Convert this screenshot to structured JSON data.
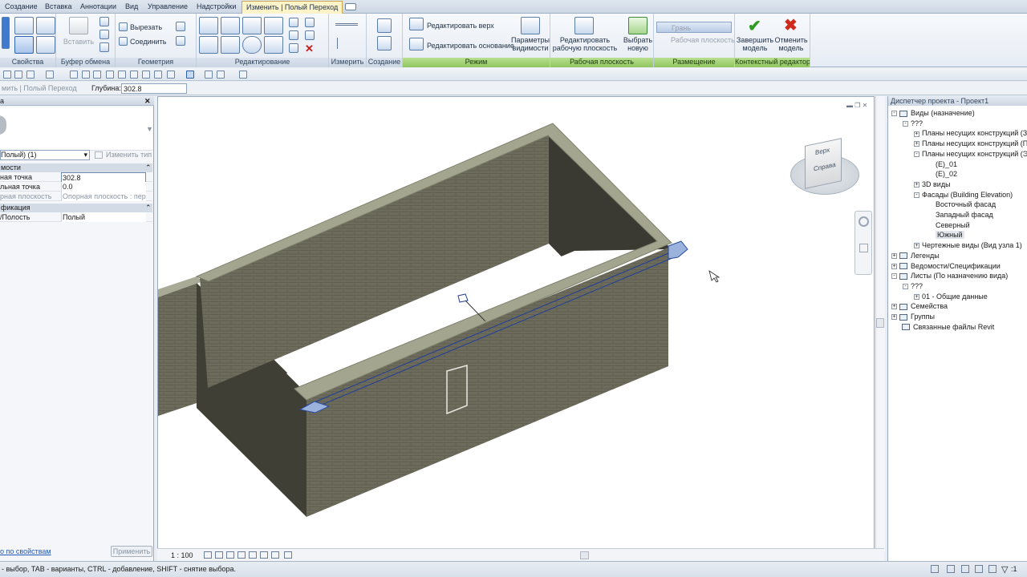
{
  "tabs": [
    "Создание",
    "Вставка",
    "Аннотации",
    "Вид",
    "Управление",
    "Надстройки",
    "Изменить | Полый Переход"
  ],
  "ribbon": {
    "panels": {
      "properties": "Свойства",
      "clipboard": "Буфер обмена",
      "geometry": "Геометрия",
      "modify": "Редактирование",
      "measure": "Измерить",
      "create": "Создание",
      "mode": "Режим",
      "workplane": "Рабочая плоскость",
      "placement": "Размещение",
      "context": "Контекстный редактор"
    },
    "paste": "Вставить",
    "cut": "Вырезать",
    "join": "Соединить",
    "edit_top": "Редактировать верх",
    "edit_base": "Редактировать основание",
    "vis_params_1": "Параметры",
    "vis_params_2": "видимости",
    "edit_wp_1": "Редактировать",
    "edit_wp_2": "рабочую плоскость",
    "pick_new_1": "Выбрать",
    "pick_new_2": "новую",
    "face": "Грань",
    "work_plane": "Рабочая плоскость",
    "finish_1": "Завершить",
    "finish_2": "модель",
    "cancel_1": "Отменить",
    "cancel_2": "модель"
  },
  "options": {
    "context": "мить | Полый Переход",
    "depth_label": "Глубина:",
    "depth_value": "302.8"
  },
  "properties": {
    "header": "а",
    "type_select": "Полый) (1)",
    "change_type": "Изменить тип",
    "sections": [
      "мости",
      "фикация"
    ],
    "rows": [
      {
        "k": "ная точка",
        "v": "302.8"
      },
      {
        "k": "льная точка",
        "v": "0.0"
      },
      {
        "k": "рная плоскость",
        "v": "Опорная плоскость : пер..."
      },
      {
        "k": "/Полость",
        "v": "Полый"
      }
    ],
    "help_link": "о по свойствам",
    "apply": "Применить"
  },
  "viewcube": {
    "top": "Верх",
    "right": "Справа"
  },
  "view_scale": "1 : 100",
  "browser": {
    "title": "Диспетчер проекта - Проект1",
    "items": [
      {
        "t": "Виды (назначение)",
        "lvl": 0,
        "b": "-",
        "i": true
      },
      {
        "t": "???",
        "lvl": 1,
        "b": "-",
        "i": false
      },
      {
        "t": "Планы несущих конструкций (За",
        "lvl": 2,
        "b": "+",
        "i": false
      },
      {
        "t": "Планы несущих конструкций (П",
        "lvl": 2,
        "b": "+",
        "i": false
      },
      {
        "t": "Планы несущих конструкций (Э",
        "lvl": 2,
        "b": "-",
        "i": false
      },
      {
        "t": "(E)_01",
        "lvl": 3,
        "b": "",
        "i": false
      },
      {
        "t": "(E)_02",
        "lvl": 3,
        "b": "",
        "i": false
      },
      {
        "t": "3D виды",
        "lvl": 2,
        "b": "+",
        "i": false
      },
      {
        "t": "Фасады (Building Elevation)",
        "lvl": 2,
        "b": "-",
        "i": false
      },
      {
        "t": "Восточный фасад",
        "lvl": 3,
        "b": "",
        "i": false
      },
      {
        "t": "Западный фасад",
        "lvl": 3,
        "b": "",
        "i": false
      },
      {
        "t": "Северный",
        "lvl": 3,
        "b": "",
        "i": false
      },
      {
        "t": "Южный",
        "lvl": 3,
        "b": "",
        "i": false
      },
      {
        "t": "Чертежные виды (Вид узла 1)",
        "lvl": 2,
        "b": "+",
        "i": false
      },
      {
        "t": "Легенды",
        "lvl": 0,
        "b": "+",
        "i": true
      },
      {
        "t": "Ведомости/Спецификации",
        "lvl": 0,
        "b": "+",
        "i": true
      },
      {
        "t": "Листы (По назначению вида)",
        "lvl": 0,
        "b": "-",
        "i": true
      },
      {
        "t": "???",
        "lvl": 1,
        "b": "-",
        "i": false
      },
      {
        "t": "01 - Общие данные",
        "lvl": 2,
        "b": "+",
        "i": false
      },
      {
        "t": "Семейства",
        "lvl": 0,
        "b": "+",
        "i": true
      },
      {
        "t": "Группы",
        "lvl": 0,
        "b": "+",
        "i": true
      },
      {
        "t": "Связанные файлы Revit",
        "lvl": 0,
        "b": "",
        "i": true
      }
    ]
  },
  "status": {
    "text": "- выбор, TAB - варианты, CTRL - добавление, SHIFT - снятие выбора.",
    "filter_count": ":1"
  }
}
